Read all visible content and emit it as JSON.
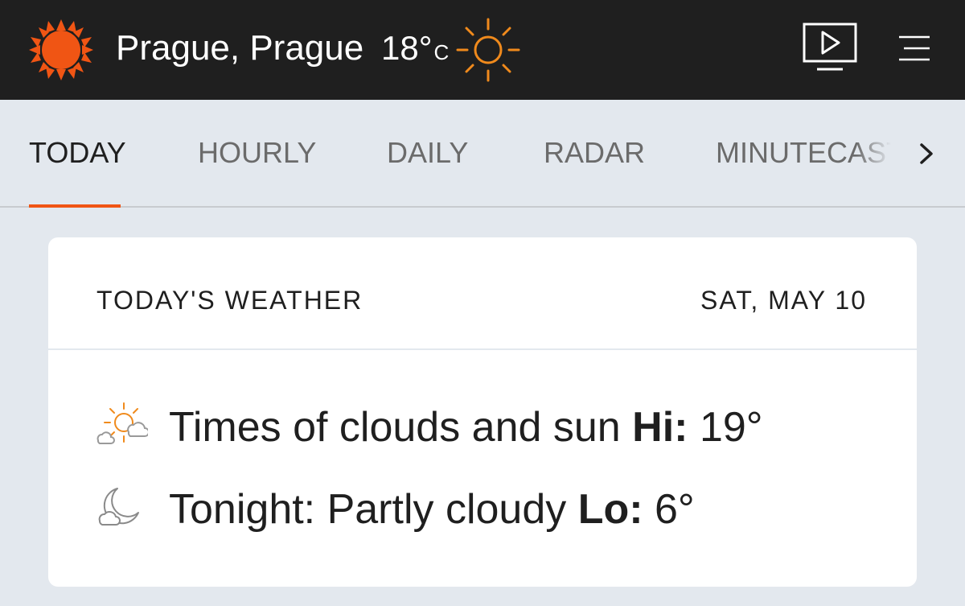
{
  "header": {
    "location": "Prague, Prague",
    "temperature": "18°",
    "temperature_unit": "C",
    "condition_icon": "sun-icon",
    "logo_icon": "accuweather-sun-logo-icon",
    "video_icon": "video-play-icon",
    "menu_icon": "hamburger-menu-icon",
    "brand_color": "#f05514",
    "background_color": "#1f1f1f"
  },
  "tabs": [
    {
      "label": "TODAY",
      "active": true
    },
    {
      "label": "HOURLY",
      "active": false
    },
    {
      "label": "DAILY",
      "active": false
    },
    {
      "label": "RADAR",
      "active": false
    },
    {
      "label": "MINUTECAST",
      "active": false
    }
  ],
  "tabs_scroll_icon": "chevron-right-icon",
  "card": {
    "title": "TODAY'S WEATHER",
    "date": "SAT, MAY 10",
    "day": {
      "icon": "partly-sunny-icon",
      "description": "Times of clouds and sun",
      "temp_label": "Hi:",
      "temp_value": "19°"
    },
    "night": {
      "icon": "partly-cloudy-night-icon",
      "description": "Tonight: Partly cloudy",
      "temp_label": "Lo:",
      "temp_value": "6°"
    }
  }
}
